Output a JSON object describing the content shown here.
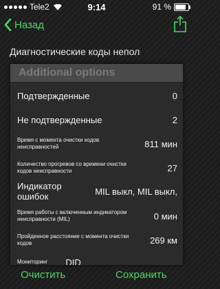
{
  "status_bar": {
    "carrier": "Tele2",
    "time": "9:14",
    "battery": "91 %",
    "battery_level": 0.91
  },
  "nav": {
    "back_label": "Назад"
  },
  "page": {
    "heading": "Диагностические коды непол"
  },
  "panel": {
    "title": "Additional options",
    "rows": [
      {
        "label": "Подтвержденные",
        "value": "0"
      },
      {
        "label": "Не подтвержденные",
        "value": "2"
      },
      {
        "label": "Время с момента очистки кодов неисправностей",
        "value": "811 мин"
      },
      {
        "label": "Количество прогревов со времени очистки кодов неисправности",
        "value": "27"
      },
      {
        "label": "Индикатор ошибок",
        "value": "MIL выкл, MIL выкл,"
      },
      {
        "label": "Время работы с включенным индикатором неисправности (MIL)",
        "value": "0 мин"
      },
      {
        "label": "Пройденное расстояние с момента очистки кодов",
        "value": "269 км"
      },
      {
        "label": "Мониторинг",
        "value": "DID"
      }
    ]
  },
  "footer": {
    "clear_label": "Очистить",
    "save_label": "Сохранить"
  },
  "colors": {
    "accent": "#4cd964",
    "panel_bg": "#2b2b2b",
    "panel_header_bg": "#4a4a4a"
  }
}
